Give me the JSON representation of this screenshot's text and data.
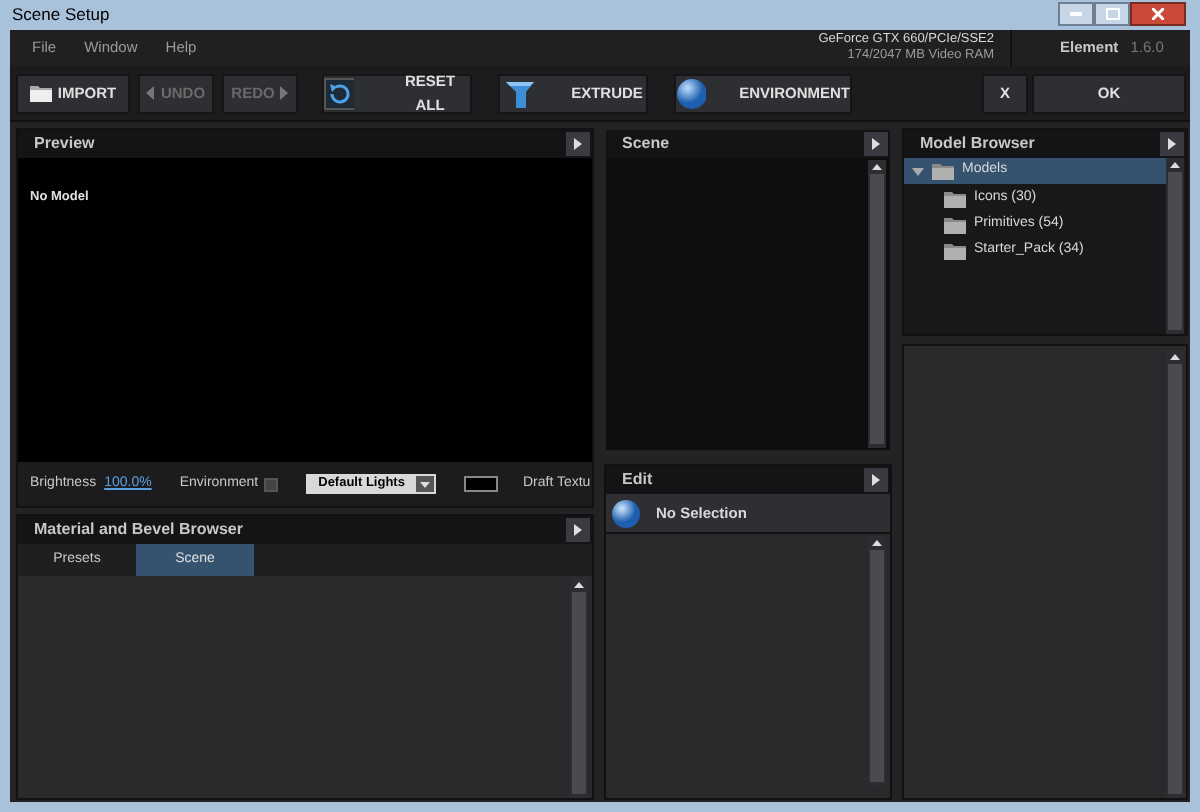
{
  "window": {
    "title": "Scene Setup"
  },
  "menu": [
    "File",
    "Window",
    "Help"
  ],
  "gpu": {
    "name": "GeForce GTX 660/PCIe/SSE2",
    "memory": "174/2047 MB Video RAM"
  },
  "app": {
    "name": "Element",
    "version": "1.6.0"
  },
  "toolbar": [
    {
      "kind": "import",
      "label": "IMPORT",
      "disabled": false
    },
    {
      "kind": "undo",
      "label": "UNDO",
      "disabled": true
    },
    {
      "kind": "redo",
      "label": "REDO",
      "disabled": true
    },
    {
      "kind": "reset",
      "label": "RESET ALL",
      "disabled": false
    },
    {
      "kind": "extrude",
      "label": "EXTRUDE",
      "disabled": false
    },
    {
      "kind": "environment",
      "label": "ENVIRONMENT",
      "disabled": false
    },
    {
      "kind": "cancel",
      "label": "X",
      "disabled": false
    },
    {
      "kind": "ok",
      "label": "OK",
      "disabled": false
    }
  ],
  "preview": {
    "title": "Preview",
    "message": "No Model",
    "brightness_label": "Brightness",
    "brightness_value": "100.0%",
    "environment_label": "Environment",
    "environment_checked": false,
    "lights": "Default Lights",
    "draft_label": "Draft Textu"
  },
  "material": {
    "title": "Material and Bevel Browser",
    "tabs": [
      {
        "label": "Presets",
        "selected": false
      },
      {
        "label": "Scene",
        "selected": true
      }
    ]
  },
  "scene": {
    "title": "Scene"
  },
  "edit": {
    "title": "Edit",
    "selection": "No Selection"
  },
  "model_browser": {
    "title": "Model Browser",
    "tree": [
      {
        "label": "Models",
        "expanded": true,
        "selected": true,
        "children": [
          {
            "label": "Icons (30)",
            "selected": false
          },
          {
            "label": "Primitives (54)",
            "selected": false
          },
          {
            "label": "Starter_Pack (34)",
            "selected": false
          }
        ]
      }
    ]
  }
}
